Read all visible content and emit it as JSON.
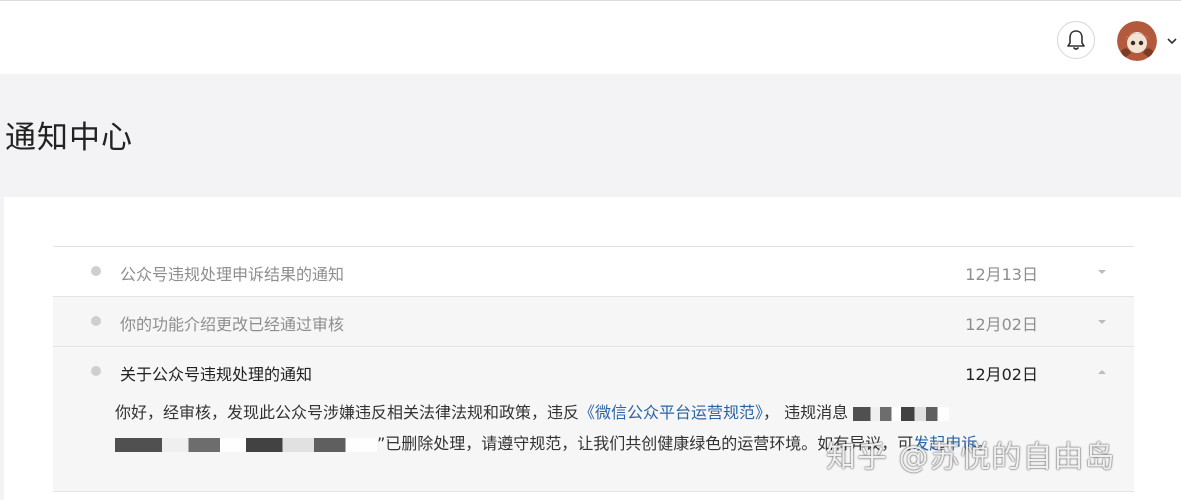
{
  "header": {
    "bell_icon": "bell-icon",
    "avatar_icon": "avatar",
    "menu_icon": "chevron-down-icon"
  },
  "page": {
    "title": "通知中心"
  },
  "notifications": [
    {
      "title": "公众号违规处理申诉结果的通知",
      "date": "12月13日",
      "expanded": false
    },
    {
      "title": "你的功能介绍更改已经通过审核",
      "date": "12月02日",
      "expanded": false
    },
    {
      "title": "关于公众号违规处理的通知",
      "date": "12月02日",
      "expanded": true,
      "body": {
        "text_1": "你好，经审核，发现此公众号涉嫌违反相关法律法规和政策，违反",
        "link_rules": "《微信公众平台运营规范》",
        "text_2": "， 违规消息",
        "text_3": "”已删除处理，请遵守规范，让我们共创健康绿色的运营环境。如有异议，可",
        "link_appeal": "发起申诉",
        "text_4": "。"
      }
    }
  ],
  "watermark": "知乎 @苏悦的自由岛",
  "colors": {
    "background": "#f3f3f5",
    "link": "#2a64a8",
    "muted_text": "#8e8e8e",
    "dot": "#cfcfcf"
  }
}
